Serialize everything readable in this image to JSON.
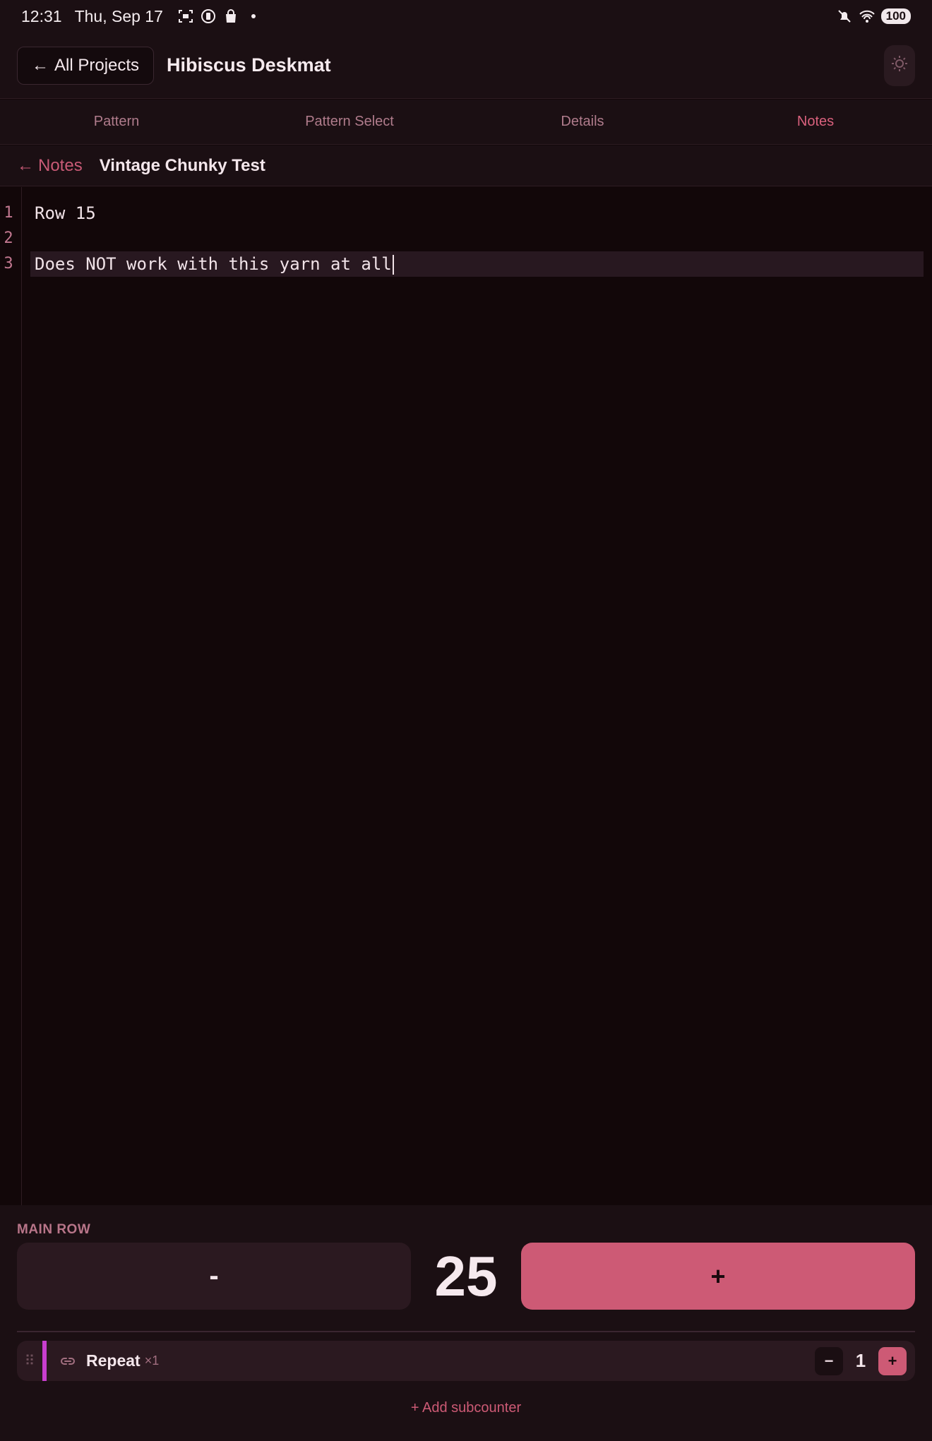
{
  "status_bar": {
    "time": "12:31",
    "date": "Thu, Sep 17",
    "battery": "100",
    "icons_left": [
      "screenshot-icon",
      "vibrate-icon",
      "bag-icon",
      "dot-icon"
    ],
    "icons_right": [
      "mute-icon",
      "wifi-icon",
      "battery-icon"
    ]
  },
  "header": {
    "back_label": "All Projects",
    "back_arrow": "←",
    "project_title": "Hibiscus Deskmat",
    "theme_icon": "sun-icon"
  },
  "tabs": [
    {
      "label": "Pattern",
      "active": false
    },
    {
      "label": "Pattern Select",
      "active": false
    },
    {
      "label": "Details",
      "active": false
    },
    {
      "label": "Notes",
      "active": true
    }
  ],
  "breadcrumb": {
    "back_label": "Notes",
    "back_arrow": "←",
    "title": "Vintage Chunky Test"
  },
  "editor": {
    "lines": [
      {
        "number": "1",
        "text": "Row 15"
      },
      {
        "number": "2",
        "text": ""
      },
      {
        "number": "3",
        "text": "Does NOT work with this yarn at all"
      }
    ],
    "current_line": 3
  },
  "counter": {
    "label": "MAIN ROW",
    "minus_label": "-",
    "value": "25",
    "plus_label": "+",
    "accent_color": "#cd5a75"
  },
  "subcounter": {
    "name": "Repeat",
    "multiplier": "×1",
    "minus_label": "−",
    "value": "1",
    "plus_label": "+",
    "accent_color": "#c93ecf",
    "icon": "link-icon"
  },
  "add_subcounter_label": "+ Add subcounter"
}
